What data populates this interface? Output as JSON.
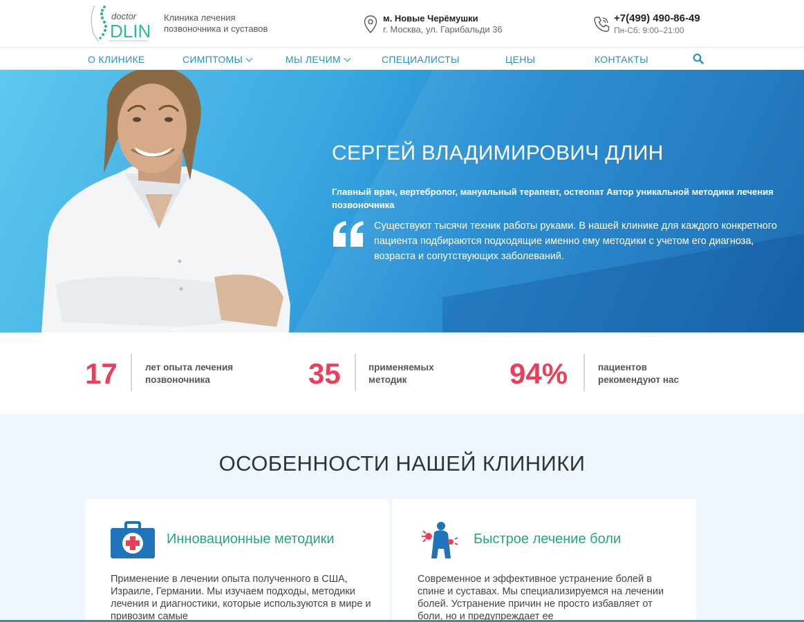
{
  "header": {
    "logo_alt": "doctor DLIN",
    "tagline_line1": "Клиника лечения",
    "tagline_line2": "позвоночника и суставов",
    "metro": "м. Новые Черёмушки",
    "address": "г. Москва, ул. Гарибальди 36",
    "phone": "+7(499) 490-86-49",
    "hours": "Пн-Сб: 9:00–21:00"
  },
  "nav": {
    "items": [
      {
        "label": "О КЛИНИКЕ",
        "dropdown": false
      },
      {
        "label": "СИМПТОМЫ",
        "dropdown": true
      },
      {
        "label": "МЫ ЛЕЧИМ",
        "dropdown": true
      },
      {
        "label": "СПЕЦИАЛИСТЫ",
        "dropdown": false
      },
      {
        "label": "ЦЕНЫ",
        "dropdown": false
      },
      {
        "label": "КОНТАКТЫ",
        "dropdown": false
      }
    ],
    "search_icon": "search-icon"
  },
  "hero": {
    "name": "СЕРГЕЙ ВЛАДИМИРОВИЧ ДЛИН",
    "role": "Главный врач, вертебролог, мануальный терапевт, остеопат Автор уникальной методики лечения позвоночника",
    "quote": "Существуют тысячи техник работы руками. В нашей клинике для каждого конкретного пациента подбираются подходящие именно ему методики с учетом его диагноза, возраста и сопутствующих заболеваний.",
    "quote_icon": "quote-icon"
  },
  "stats": [
    {
      "value": "17",
      "label_line1": "лет опыта лечения",
      "label_line2": "позвоночника"
    },
    {
      "value": "35",
      "label_line1": "применяемых",
      "label_line2": "методик"
    },
    {
      "value": "94%",
      "label_line1": "пациентов",
      "label_line2": "рекомендуют нас"
    }
  ],
  "features": {
    "title": "ОСОБЕННОСТИ НАШЕЙ КЛИНИКИ",
    "cards": [
      {
        "icon": "medical-kit-icon",
        "title": "Инновационные методики",
        "text": "Применение в лечении опыта полученного в США, Израиле, Германии. Мы изучаем подходы, методики лечения и диагностики, которые используются в мире и привозим самые"
      },
      {
        "icon": "back-pain-icon",
        "title": "Быстрое лечение боли",
        "text": "Современное и эффективное устранение болей в спине и суставах. Мы специализируемся на лечении болей. Устранение причин не просто избавляет от боли, но и предупреждает ее"
      }
    ]
  },
  "colors": {
    "accent_blue": "#2a8fb7",
    "stat_red": "#e8405b",
    "feature_green": "#23a77a"
  }
}
